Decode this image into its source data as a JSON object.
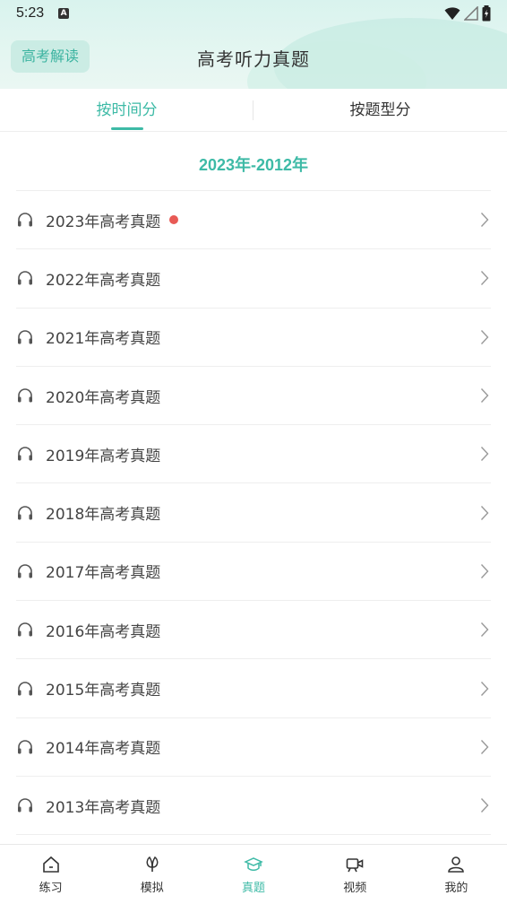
{
  "status_bar": {
    "time": "5:23",
    "notification_icon": "A"
  },
  "header": {
    "back_label": "高考解读",
    "title": "高考听力真题"
  },
  "tabs": [
    {
      "label": "按时间分",
      "active": true
    },
    {
      "label": "按题型分",
      "active": false
    }
  ],
  "section": {
    "title": "2023年-2012年"
  },
  "list": [
    {
      "label": "2023年高考真题",
      "unread": true
    },
    {
      "label": "2022年高考真题",
      "unread": false
    },
    {
      "label": "2021年高考真题",
      "unread": false
    },
    {
      "label": "2020年高考真题",
      "unread": false
    },
    {
      "label": "2019年高考真题",
      "unread": false
    },
    {
      "label": "2018年高考真题",
      "unread": false
    },
    {
      "label": "2017年高考真题",
      "unread": false
    },
    {
      "label": "2016年高考真题",
      "unread": false
    },
    {
      "label": "2015年高考真题",
      "unread": false
    },
    {
      "label": "2014年高考真题",
      "unread": false
    },
    {
      "label": "2013年高考真题",
      "unread": false
    }
  ],
  "bottom_nav": [
    {
      "label": "练习",
      "icon": "home-icon",
      "active": false
    },
    {
      "label": "模拟",
      "icon": "leaf-icon",
      "active": false
    },
    {
      "label": "真题",
      "icon": "graduation-cap-icon",
      "active": true
    },
    {
      "label": "视频",
      "icon": "video-camera-icon",
      "active": false
    },
    {
      "label": "我的",
      "icon": "user-icon",
      "active": false
    }
  ],
  "colors": {
    "accent": "#3dbaa6",
    "unread_dot": "#e85a55",
    "header_bg": "#d9f3ee"
  }
}
